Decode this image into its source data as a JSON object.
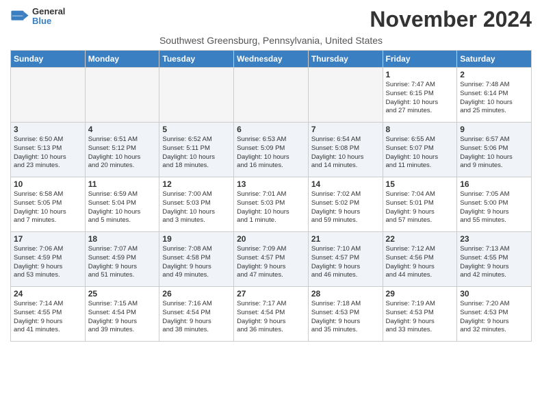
{
  "logo": {
    "general": "General",
    "blue": "Blue"
  },
  "title": "November 2024",
  "subtitle": "Southwest Greensburg, Pennsylvania, United States",
  "days": [
    "Sunday",
    "Monday",
    "Tuesday",
    "Wednesday",
    "Thursday",
    "Friday",
    "Saturday"
  ],
  "weeks": [
    [
      {
        "day": "",
        "text": ""
      },
      {
        "day": "",
        "text": ""
      },
      {
        "day": "",
        "text": ""
      },
      {
        "day": "",
        "text": ""
      },
      {
        "day": "",
        "text": ""
      },
      {
        "day": "1",
        "text": "Sunrise: 7:47 AM\nSunset: 6:15 PM\nDaylight: 10 hours\nand 27 minutes."
      },
      {
        "day": "2",
        "text": "Sunrise: 7:48 AM\nSunset: 6:14 PM\nDaylight: 10 hours\nand 25 minutes."
      }
    ],
    [
      {
        "day": "3",
        "text": "Sunrise: 6:50 AM\nSunset: 5:13 PM\nDaylight: 10 hours\nand 23 minutes."
      },
      {
        "day": "4",
        "text": "Sunrise: 6:51 AM\nSunset: 5:12 PM\nDaylight: 10 hours\nand 20 minutes."
      },
      {
        "day": "5",
        "text": "Sunrise: 6:52 AM\nSunset: 5:11 PM\nDaylight: 10 hours\nand 18 minutes."
      },
      {
        "day": "6",
        "text": "Sunrise: 6:53 AM\nSunset: 5:09 PM\nDaylight: 10 hours\nand 16 minutes."
      },
      {
        "day": "7",
        "text": "Sunrise: 6:54 AM\nSunset: 5:08 PM\nDaylight: 10 hours\nand 14 minutes."
      },
      {
        "day": "8",
        "text": "Sunrise: 6:55 AM\nSunset: 5:07 PM\nDaylight: 10 hours\nand 11 minutes."
      },
      {
        "day": "9",
        "text": "Sunrise: 6:57 AM\nSunset: 5:06 PM\nDaylight: 10 hours\nand 9 minutes."
      }
    ],
    [
      {
        "day": "10",
        "text": "Sunrise: 6:58 AM\nSunset: 5:05 PM\nDaylight: 10 hours\nand 7 minutes."
      },
      {
        "day": "11",
        "text": "Sunrise: 6:59 AM\nSunset: 5:04 PM\nDaylight: 10 hours\nand 5 minutes."
      },
      {
        "day": "12",
        "text": "Sunrise: 7:00 AM\nSunset: 5:03 PM\nDaylight: 10 hours\nand 3 minutes."
      },
      {
        "day": "13",
        "text": "Sunrise: 7:01 AM\nSunset: 5:03 PM\nDaylight: 10 hours\nand 1 minute."
      },
      {
        "day": "14",
        "text": "Sunrise: 7:02 AM\nSunset: 5:02 PM\nDaylight: 9 hours\nand 59 minutes."
      },
      {
        "day": "15",
        "text": "Sunrise: 7:04 AM\nSunset: 5:01 PM\nDaylight: 9 hours\nand 57 minutes."
      },
      {
        "day": "16",
        "text": "Sunrise: 7:05 AM\nSunset: 5:00 PM\nDaylight: 9 hours\nand 55 minutes."
      }
    ],
    [
      {
        "day": "17",
        "text": "Sunrise: 7:06 AM\nSunset: 4:59 PM\nDaylight: 9 hours\nand 53 minutes."
      },
      {
        "day": "18",
        "text": "Sunrise: 7:07 AM\nSunset: 4:59 PM\nDaylight: 9 hours\nand 51 minutes."
      },
      {
        "day": "19",
        "text": "Sunrise: 7:08 AM\nSunset: 4:58 PM\nDaylight: 9 hours\nand 49 minutes."
      },
      {
        "day": "20",
        "text": "Sunrise: 7:09 AM\nSunset: 4:57 PM\nDaylight: 9 hours\nand 47 minutes."
      },
      {
        "day": "21",
        "text": "Sunrise: 7:10 AM\nSunset: 4:57 PM\nDaylight: 9 hours\nand 46 minutes."
      },
      {
        "day": "22",
        "text": "Sunrise: 7:12 AM\nSunset: 4:56 PM\nDaylight: 9 hours\nand 44 minutes."
      },
      {
        "day": "23",
        "text": "Sunrise: 7:13 AM\nSunset: 4:55 PM\nDaylight: 9 hours\nand 42 minutes."
      }
    ],
    [
      {
        "day": "24",
        "text": "Sunrise: 7:14 AM\nSunset: 4:55 PM\nDaylight: 9 hours\nand 41 minutes."
      },
      {
        "day": "25",
        "text": "Sunrise: 7:15 AM\nSunset: 4:54 PM\nDaylight: 9 hours\nand 39 minutes."
      },
      {
        "day": "26",
        "text": "Sunrise: 7:16 AM\nSunset: 4:54 PM\nDaylight: 9 hours\nand 38 minutes."
      },
      {
        "day": "27",
        "text": "Sunrise: 7:17 AM\nSunset: 4:54 PM\nDaylight: 9 hours\nand 36 minutes."
      },
      {
        "day": "28",
        "text": "Sunrise: 7:18 AM\nSunset: 4:53 PM\nDaylight: 9 hours\nand 35 minutes."
      },
      {
        "day": "29",
        "text": "Sunrise: 7:19 AM\nSunset: 4:53 PM\nDaylight: 9 hours\nand 33 minutes."
      },
      {
        "day": "30",
        "text": "Sunrise: 7:20 AM\nSunset: 4:53 PM\nDaylight: 9 hours\nand 32 minutes."
      }
    ]
  ]
}
